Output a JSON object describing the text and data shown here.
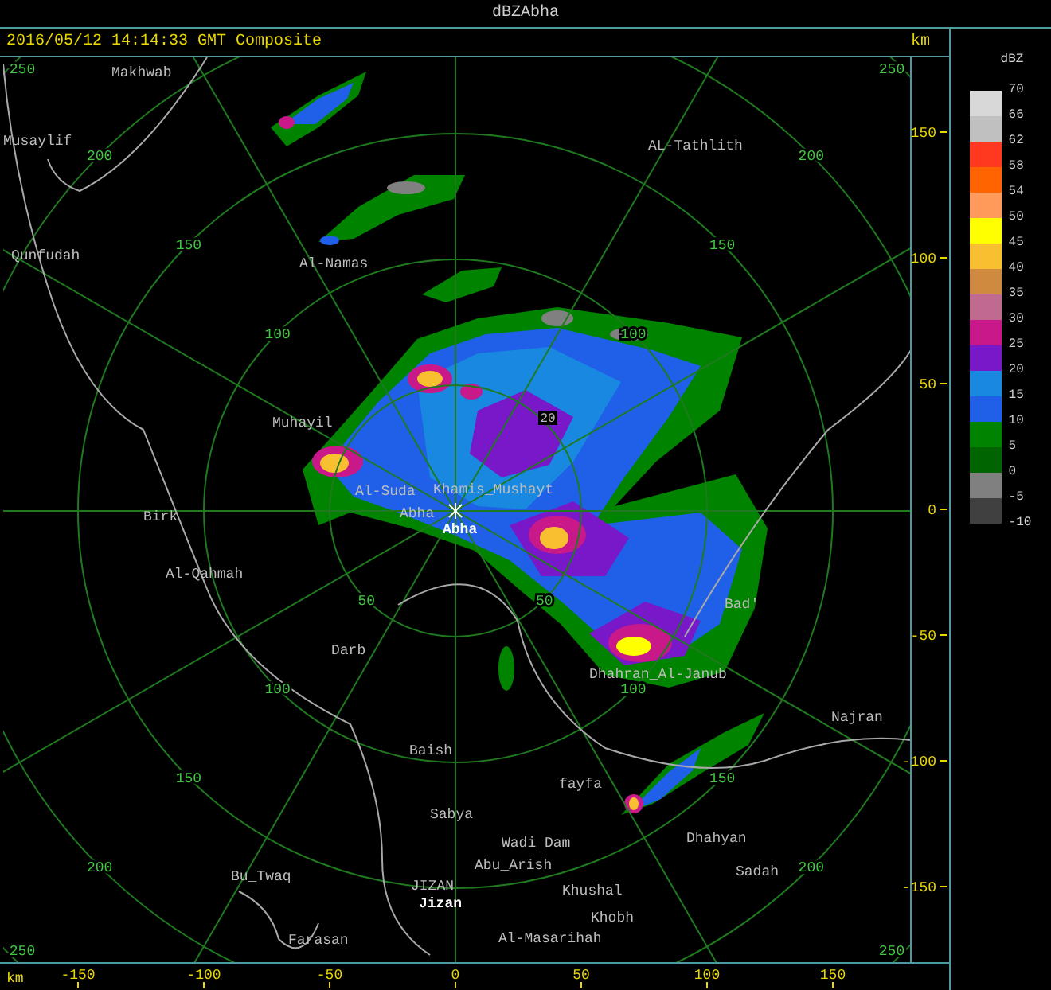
{
  "window": {
    "title": "dBZAbha"
  },
  "header": {
    "timestamp": "2016/05/12 14:14:33 GMT Composite",
    "unit": "km"
  },
  "map": {
    "range_labels": {
      "nw": [
        "250",
        "200",
        "150",
        "100"
      ],
      "ne": [
        "250",
        "200",
        "150",
        "100"
      ],
      "sw": [
        "250",
        "200",
        "150",
        "100",
        "50"
      ],
      "se": [
        "250",
        "200",
        "150",
        "100",
        "50"
      ]
    },
    "cell_marker": "20",
    "places": [
      {
        "name": "Makhwab",
        "kind": "town"
      },
      {
        "name": "Musaylif",
        "kind": "town"
      },
      {
        "name": "Qunfudah",
        "kind": "town"
      },
      {
        "name": "Al-Namas",
        "kind": "town"
      },
      {
        "name": "AL-Tathlith",
        "kind": "town"
      },
      {
        "name": "Muhayil",
        "kind": "town"
      },
      {
        "name": "Birk",
        "kind": "town"
      },
      {
        "name": "Al-Suda",
        "kind": "town"
      },
      {
        "name": "Khamis_Mushayt",
        "kind": "town"
      },
      {
        "name": "Abha",
        "kind": "town"
      },
      {
        "name": "Abha",
        "kind": "station"
      },
      {
        "name": "Al-Qahmah",
        "kind": "town"
      },
      {
        "name": "Darb",
        "kind": "town"
      },
      {
        "name": "Bad'",
        "kind": "town"
      },
      {
        "name": "Dhahran_Al-Janub",
        "kind": "town"
      },
      {
        "name": "Najran",
        "kind": "town"
      },
      {
        "name": "Baish",
        "kind": "town"
      },
      {
        "name": "fayfa",
        "kind": "town"
      },
      {
        "name": "Sabya",
        "kind": "town"
      },
      {
        "name": "Wadi_Dam",
        "kind": "town"
      },
      {
        "name": "Abu_Arish",
        "kind": "town"
      },
      {
        "name": "Dhahyan",
        "kind": "town"
      },
      {
        "name": "Sadah",
        "kind": "town"
      },
      {
        "name": "Bu_Twaq",
        "kind": "town"
      },
      {
        "name": "JIZAN",
        "kind": "town"
      },
      {
        "name": "Jizan",
        "kind": "station"
      },
      {
        "name": "Khushal",
        "kind": "town"
      },
      {
        "name": "Khobh",
        "kind": "town"
      },
      {
        "name": "Al-Masarihah",
        "kind": "town"
      },
      {
        "name": "Farasan",
        "kind": "town"
      }
    ],
    "y_axis": {
      "labels": [
        "150",
        "100",
        "50",
        "0",
        "-50",
        "-100",
        "-150"
      ]
    },
    "x_axis": {
      "unit": "km",
      "labels": [
        "-150",
        "-100",
        "-50",
        "0",
        "50",
        "100",
        "150"
      ]
    }
  },
  "legend": {
    "title": "dBZ",
    "labels": [
      "70",
      "66",
      "62",
      "58",
      "54",
      "50",
      "45",
      "40",
      "35",
      "30",
      "25",
      "20",
      "15",
      "10",
      "5",
      "0",
      "-5",
      "-10"
    ],
    "bands": [
      {
        "color": "#d8d8d8"
      },
      {
        "color": "#c0c0c0"
      },
      {
        "color": "#ff3820"
      },
      {
        "color": "#ff6400"
      },
      {
        "color": "#ff9a5a"
      },
      {
        "color": "#ffff00"
      },
      {
        "color": "#f8c030"
      },
      {
        "color": "#d08a40"
      },
      {
        "color": "#c06a90"
      },
      {
        "color": "#c8188a"
      },
      {
        "color": "#7818c8"
      },
      {
        "color": "#1888e0"
      },
      {
        "color": "#2060e8"
      },
      {
        "color": "#008400"
      },
      {
        "color": "#006400"
      },
      {
        "color": "#808080"
      },
      {
        "color": "#404040"
      }
    ]
  }
}
